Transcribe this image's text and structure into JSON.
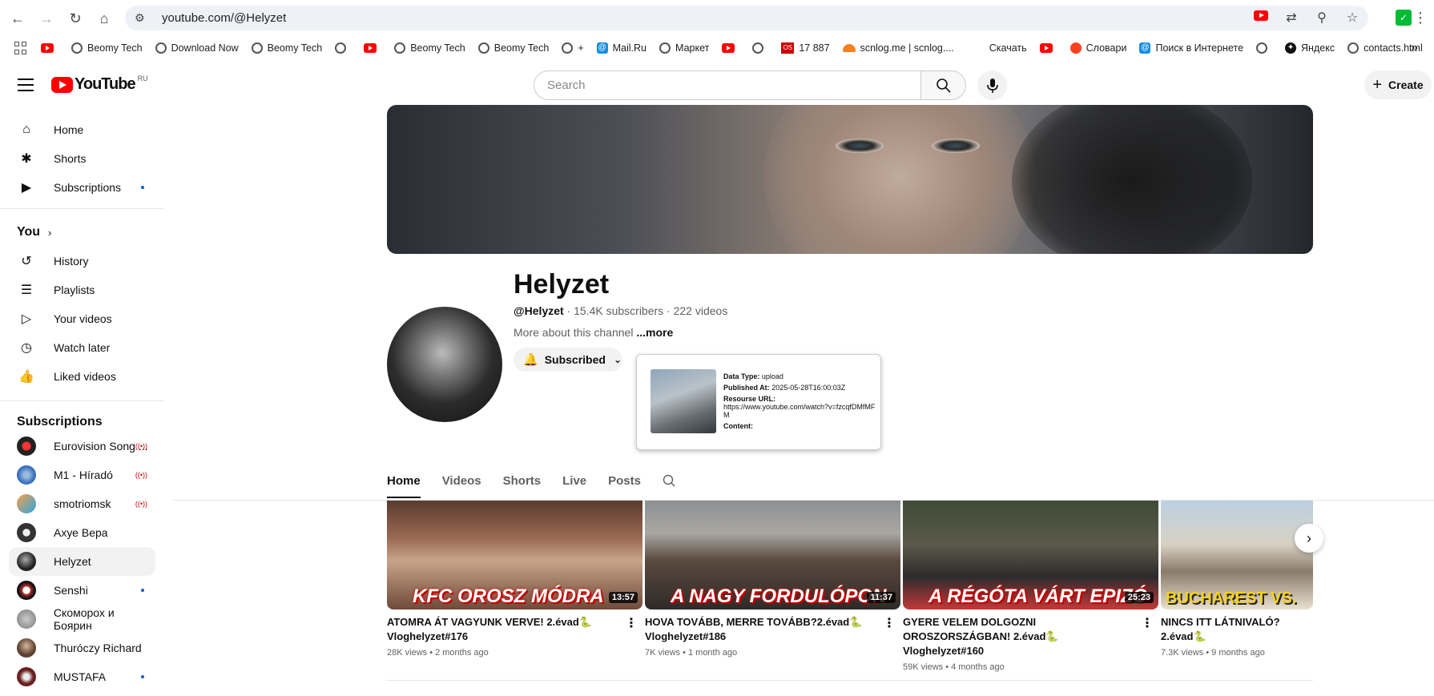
{
  "browser": {
    "url": "youtube.com/@Helyzet",
    "bookmarks": [
      "Beomy Tech",
      "Download Now",
      "Beomy Tech",
      "Beomy Tech",
      "Beomy Tech",
      "+",
      "Mail.Ru",
      "Маркет",
      "17 887",
      "scnlog.me | scnlog....",
      "Скачать",
      "Словари",
      "Поиск в Интернете",
      "Яндекс",
      "contacts.html"
    ]
  },
  "header": {
    "logo_text": "YouTube",
    "country_code": "RU",
    "search_placeholder": "Search",
    "create_label": "Create"
  },
  "sidebar": {
    "main": [
      {
        "label": "Home",
        "icon": "home-icon"
      },
      {
        "label": "Shorts",
        "icon": "shorts-icon"
      },
      {
        "label": "Subscriptions",
        "icon": "subscriptions-icon"
      }
    ],
    "you_label": "You",
    "you_items": [
      {
        "label": "History",
        "icon": "history-icon"
      },
      {
        "label": "Playlists",
        "icon": "playlists-icon"
      },
      {
        "label": "Your videos",
        "icon": "your-videos-icon"
      },
      {
        "label": "Watch later",
        "icon": "watch-later-icon"
      },
      {
        "label": "Liked videos",
        "icon": "liked-videos-icon"
      }
    ],
    "subscriptions_label": "Subscriptions",
    "subscriptions": [
      {
        "label": "Eurovision Song ...",
        "color": "#d01010",
        "badge": "live"
      },
      {
        "label": "M1 - Híradó",
        "color": "#3a6fc0",
        "badge": "live"
      },
      {
        "label": "smotriomsk",
        "color": "#e05a2a",
        "badge": "live"
      },
      {
        "label": "Ахуе Вера",
        "color": "#333333",
        "badge": ""
      },
      {
        "label": "Helyzet",
        "color": "#222222",
        "badge": ""
      },
      {
        "label": "Senshi",
        "color": "#c03030",
        "badge": "dot"
      },
      {
        "label": "Скоморох и Боярин",
        "color": "#8a8a8a",
        "badge": ""
      },
      {
        "label": "Thuróczy Richard",
        "color": "#5a4030",
        "badge": ""
      },
      {
        "label": "MUSTAFA",
        "color": "#6a2020",
        "badge": "dot"
      }
    ]
  },
  "channel": {
    "name": "Helyzet",
    "handle": "@Helyzet",
    "stats": " · 15.4K subscribers · 222 videos",
    "about": "More about this channel ",
    "more": "...more",
    "subscribed_label": "Subscribed"
  },
  "popup": {
    "data_type_label": "Data Type:",
    "data_type": "upload",
    "published_label": "Published At:",
    "published": "2025-05-28T16:00:03Z",
    "resource_label": "Resourse URL:",
    "resource": "https://www.youtube.com/watch?v=fzcqfDMfMFM",
    "content_label": "Content:"
  },
  "tabs": [
    "Home",
    "Videos",
    "Shorts",
    "Live",
    "Posts"
  ],
  "videos": [
    {
      "caption": "KFC OROSZ MÓDRA",
      "duration": "13:57",
      "title": "ATOMRA ÁT VAGYUNK VERVE! 2.évad🐍 Vloghelyzet#176",
      "meta": "28K views • 2 months ago"
    },
    {
      "caption": "A NAGY FORDULÓPON",
      "duration": "11:37",
      "title": "HOVA TOVÁBB, MERRE TOVÁBB?2.évad🐍 Vloghelyzet#186",
      "meta": "7K views • 1 month ago"
    },
    {
      "caption": "A RÉGÓTA VÁRT EPIZÓ",
      "duration": "25:23",
      "title": "GYERE VELEM DOLGOZNI OROSZORSZÁGBAN! 2.évad🐍 Vloghelyzet#160",
      "meta": "59K views • 4 months ago"
    },
    {
      "caption": "BUCHAREST VS.",
      "duration": "",
      "title": "NINCS ITT LÁTNIVALÓ? 2.évad🐍",
      "meta": "7.3K views • 9 months ago"
    }
  ]
}
